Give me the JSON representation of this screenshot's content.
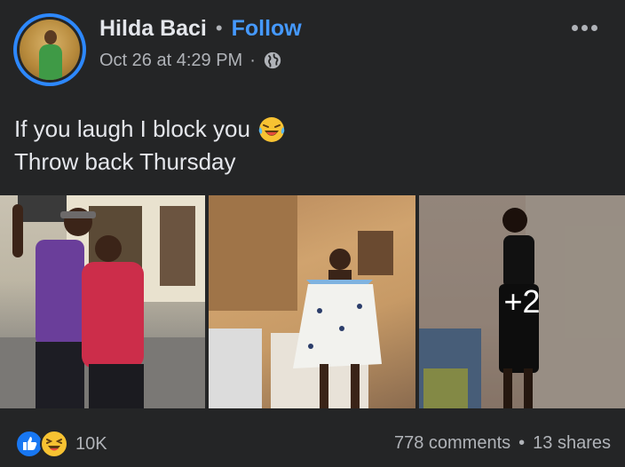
{
  "post": {
    "author": "Hilda Baci",
    "follow_label": "Follow",
    "timestamp": "Oct 26 at 4:29 PM",
    "audience_icon": "globe-icon",
    "more_icon": "more-options-icon",
    "caption_line1": "If you laugh I block you",
    "caption_line2": "Throw back Thursday",
    "caption_emoji": "laughing-with-tears-emoji",
    "extra_photos_label": "+2",
    "photos": [
      {
        "name": "photo-1"
      },
      {
        "name": "photo-2"
      },
      {
        "name": "photo-3"
      }
    ]
  },
  "footer": {
    "reaction_icons": [
      "like-reaction-icon",
      "haha-reaction-icon"
    ],
    "reaction_count": "10K",
    "comments": "778 comments",
    "shares": "13 shares"
  },
  "colors": {
    "background": "#242526",
    "follow_blue": "#4599ff",
    "avatar_ring": "#2d88ff",
    "text_primary": "#e4e6eb",
    "text_secondary": "#b0b3b8"
  }
}
